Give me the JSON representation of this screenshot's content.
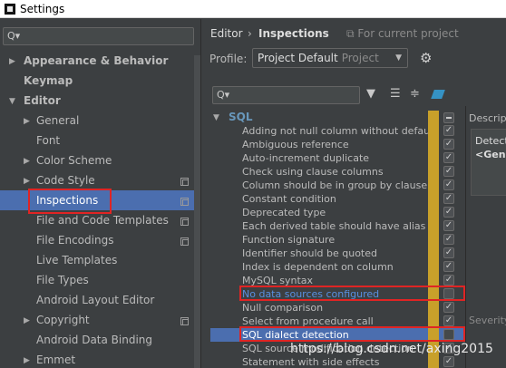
{
  "window": {
    "title": "Settings"
  },
  "left_panel": {
    "search": {
      "value": ""
    },
    "tree": [
      {
        "label": "Appearance & Behavior",
        "arrow": "▶",
        "bold": true
      },
      {
        "label": "Keymap",
        "bold": true
      },
      {
        "label": "Editor",
        "arrow": "▼",
        "bold": true
      },
      {
        "label": "General",
        "arrow": "▶"
      },
      {
        "label": "Font"
      },
      {
        "label": "Color Scheme",
        "arrow": "▶"
      },
      {
        "label": "Code Style",
        "arrow": "▶",
        "copy_icon": true
      },
      {
        "label": "Inspections",
        "selected": true,
        "copy_icon": true
      },
      {
        "label": "File and Code Templates",
        "copy_icon": true
      },
      {
        "label": "File Encodings",
        "copy_icon": true
      },
      {
        "label": "Live Templates"
      },
      {
        "label": "File Types"
      },
      {
        "label": "Android Layout Editor"
      },
      {
        "label": "Copyright",
        "arrow": "▶",
        "copy_icon": true
      },
      {
        "label": "Android Data Binding"
      },
      {
        "label": "Emmet",
        "arrow": "▶"
      }
    ]
  },
  "breadcrumb": {
    "editor": "Editor",
    "separator": "›",
    "inspections": "Inspections",
    "scope": "For current project"
  },
  "profile": {
    "label": "Profile:",
    "selected": "Project Default",
    "type": "Project"
  },
  "inspections": {
    "group": "SQL",
    "items": [
      {
        "label": "Adding not null column without default",
        "checked": true
      },
      {
        "label": "Ambiguous reference",
        "checked": true
      },
      {
        "label": "Auto-increment duplicate",
        "checked": true
      },
      {
        "label": "Check using clause columns",
        "checked": true
      },
      {
        "label": "Column should be in group by clause",
        "checked": true
      },
      {
        "label": "Constant condition",
        "checked": true
      },
      {
        "label": "Deprecated type",
        "checked": true
      },
      {
        "label": "Each derived table should have alias",
        "checked": true
      },
      {
        "label": "Function signature",
        "checked": true
      },
      {
        "label": "Identifier should be quoted",
        "checked": true
      },
      {
        "label": "Index is dependent on column",
        "checked": true
      },
      {
        "label": "MySQL syntax",
        "checked": true
      },
      {
        "label": "No data sources configured",
        "checked": false,
        "error": true
      },
      {
        "label": "Null comparison",
        "checked": true
      },
      {
        "label": "Select from procedure call",
        "checked": true
      },
      {
        "label": "SQL dialect detection",
        "checked": false,
        "selected": true
      },
      {
        "label": "SQL source modification detection",
        "checked": true
      },
      {
        "label": "Statement with side effects",
        "checked": true
      }
    ]
  },
  "description": {
    "label": "Descript",
    "line1": "Detect",
    "line2": "<Gene"
  },
  "severity": {
    "label": "Severity"
  },
  "watermark": "https://blog.csdn.net/axing2015",
  "colors": {
    "accent": "#4b6eaf",
    "highlight_box": "#e02424",
    "warning": "#c8a02a",
    "link": "#5890e0"
  }
}
